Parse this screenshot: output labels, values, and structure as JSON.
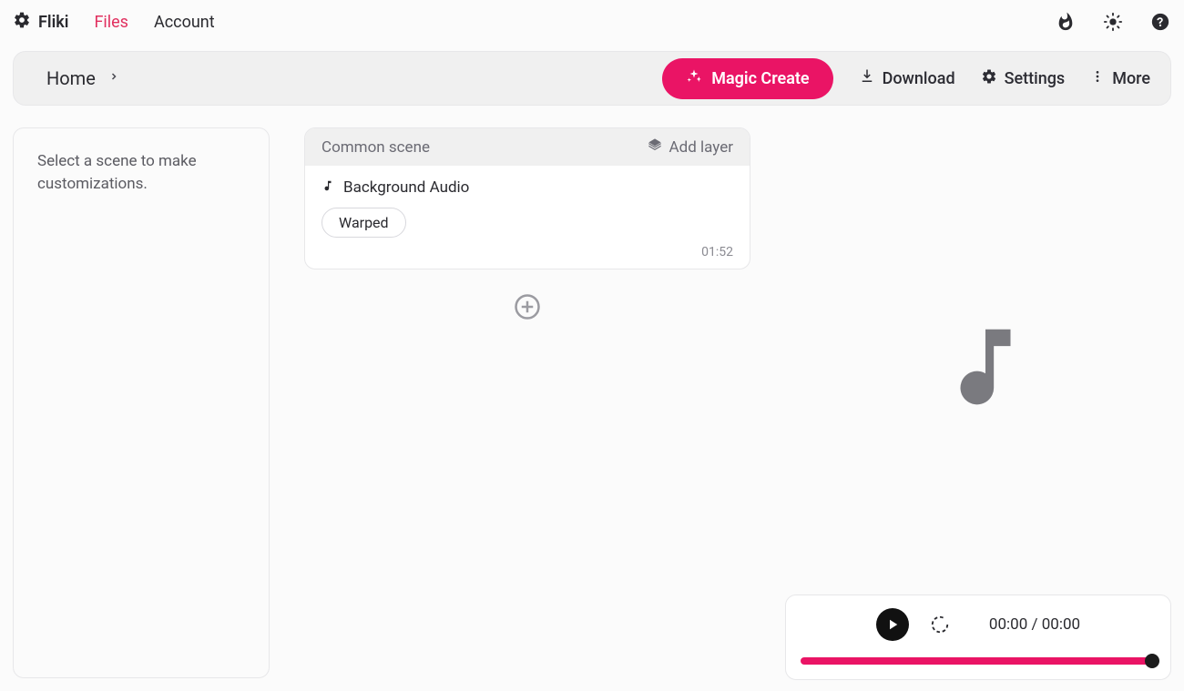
{
  "nav": {
    "brand": "Fliki",
    "links": [
      "Files",
      "Account"
    ],
    "activeLinkIndex": 0
  },
  "toolbar": {
    "breadcrumb": [
      "Home"
    ],
    "magicCreate": "Magic Create",
    "download": "Download",
    "settings": "Settings",
    "more": "More"
  },
  "sidePanel": {
    "message": "Select a scene to make customizations."
  },
  "scene": {
    "title": "Common scene",
    "addLayer": "Add layer",
    "layerLabel": "Background Audio",
    "trackName": "Warped",
    "duration": "01:52"
  },
  "player": {
    "current": "00:00",
    "separator": " / ",
    "total": "00:00"
  }
}
